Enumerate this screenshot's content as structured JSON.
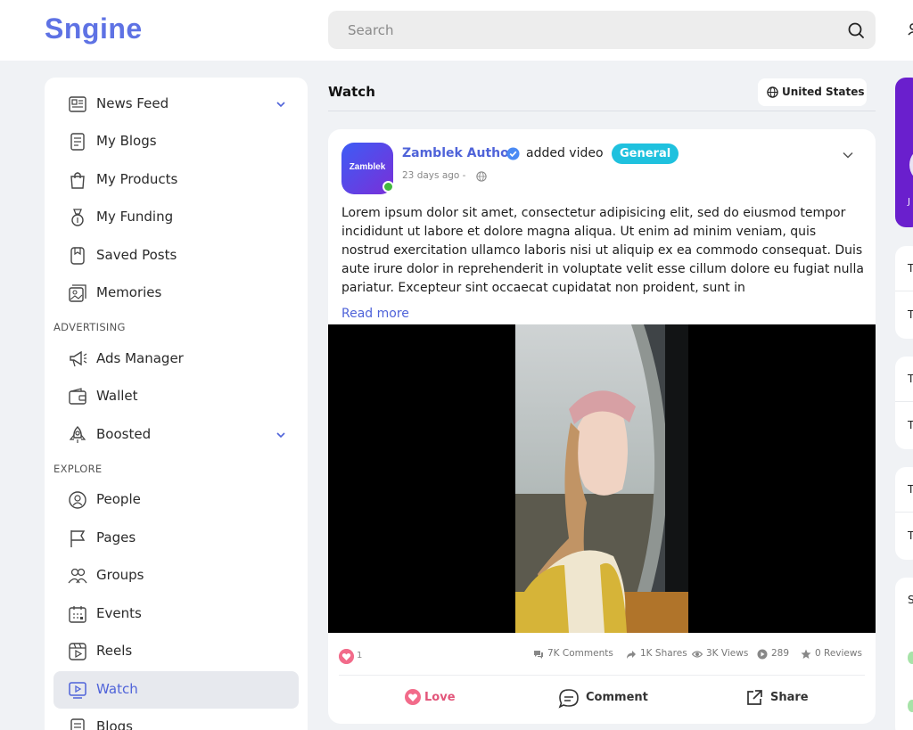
{
  "header": {
    "logo": "Sngine",
    "search_placeholder": "Search"
  },
  "sidebar": {
    "items": [
      {
        "label": "News Feed",
        "icon": "news-icon",
        "chevron": true
      },
      {
        "label": "My Blogs",
        "icon": "blog-icon"
      },
      {
        "label": "My Products",
        "icon": "shopping-bag-icon"
      },
      {
        "label": "My Funding",
        "icon": "funding-icon"
      },
      {
        "label": "Saved Posts",
        "icon": "bookmark-icon"
      },
      {
        "label": "Memories",
        "icon": "memories-icon"
      }
    ],
    "advertising_title": "ADVERTISING",
    "advertising_items": [
      {
        "label": "Ads Manager",
        "icon": "megaphone-icon"
      },
      {
        "label": "Wallet",
        "icon": "wallet-icon"
      },
      {
        "label": "Boosted",
        "icon": "rocket-icon",
        "chevron": true
      }
    ],
    "explore_title": "EXPLORE",
    "explore_items": [
      {
        "label": "People",
        "icon": "people-icon"
      },
      {
        "label": "Pages",
        "icon": "flag-icon"
      },
      {
        "label": "Groups",
        "icon": "groups-icon"
      },
      {
        "label": "Events",
        "icon": "calendar-icon"
      },
      {
        "label": "Reels",
        "icon": "reels-icon"
      },
      {
        "label": "Watch",
        "icon": "watch-icon",
        "active": true
      },
      {
        "label": "Blogs",
        "icon": "blog-icon"
      }
    ]
  },
  "watch": {
    "title": "Watch",
    "country": "United States"
  },
  "post": {
    "avatar_text": "Zamblek",
    "author": "Zamblek Author",
    "action": "added video",
    "badge": "General",
    "time": "23 days ago -",
    "text": "Lorem ipsum dolor sit amet, consectetur adipisicing elit, sed do eiusmod tempor incididunt ut labore et dolore magna aliqua. Ut enim ad minim veniam, quis nostrud exercitation ullamco laboris nisi ut aliquip ex ea commodo consequat. Duis aute irure dolor in reprehenderit in voluptate velit esse cillum dolore eu fugiat nulla pariatur. Excepteur sint occaecat cupidatat non proident, sunt in",
    "read_more": "Read more",
    "reaction_count": "1",
    "stats": {
      "comments": "7K Comments",
      "shares": "1K Shares",
      "views": "3K Views",
      "plays": "289",
      "reviews": "0 Reviews"
    },
    "actions": {
      "love": "Love",
      "comment": "Comment",
      "share": "Share"
    }
  },
  "colors": {
    "brand": "#5e72e4",
    "active_text": "#4f63d9",
    "badge": "#1fc1de",
    "love": "#f26b8a",
    "purple_panel": "#6a1fcd"
  },
  "right": {
    "letters": [
      "J",
      "T",
      "T",
      "T",
      "T",
      "T",
      "T",
      "S"
    ]
  }
}
